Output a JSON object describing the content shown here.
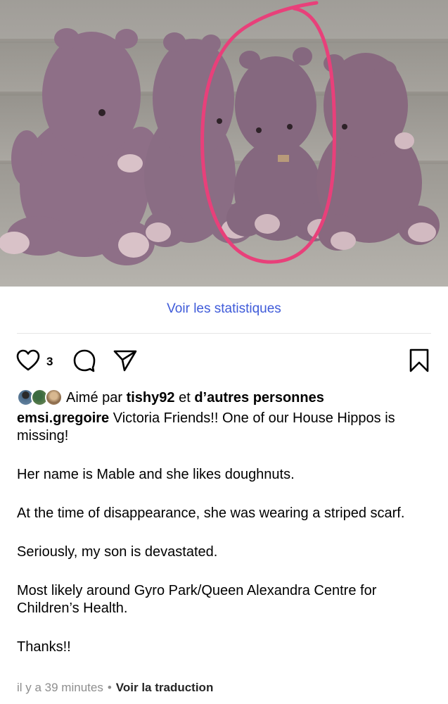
{
  "photo": {
    "subject": "four purple plush hippos on carpeted stairs, one circled in pink",
    "highlight_color": "#e8407a"
  },
  "post": {
    "stats_link": "Voir les statistiques",
    "likes_count": "3",
    "liked_by": {
      "prefix": "Aimé par",
      "user": "tishy92",
      "connector": "et",
      "others": "d’autres personnes"
    },
    "author": "emsi.gregoire",
    "caption_paragraphs": [
      "Victoria Friends!! One of our House Hippos is missing!",
      "Her name is Mable and she likes doughnuts.",
      "At the time of disappearance, she was wearing a striped scarf.",
      "Seriously, my son is devastated.",
      "Most likely around Gyro Park/Queen Alexandra Centre for Children’s Health.",
      "Thanks!!"
    ],
    "timestamp": "il y a 39 minutes",
    "separator": "•",
    "translate_link": "Voir la traduction"
  },
  "icons": [
    "heart-icon",
    "comment-icon",
    "share-icon",
    "bookmark-icon"
  ],
  "colors": {
    "link": "#3f5bd9",
    "meta": "#8e8e8e",
    "plush": "#8d6f86"
  }
}
